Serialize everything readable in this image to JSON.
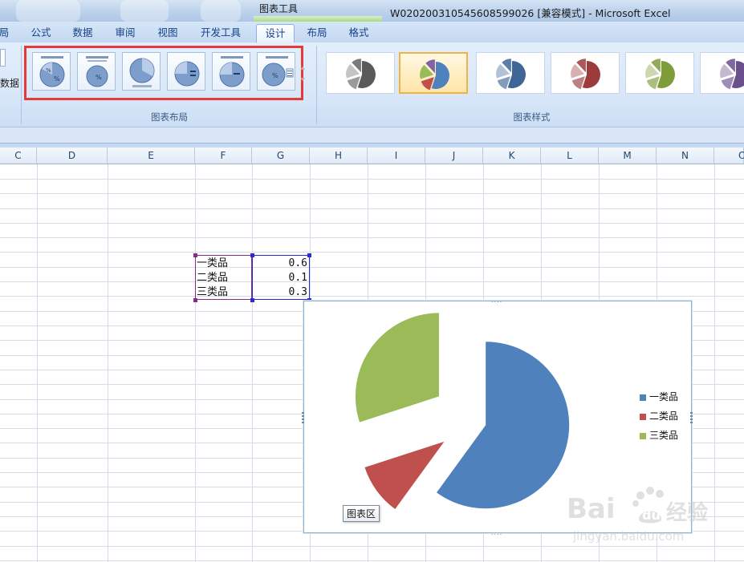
{
  "window": {
    "context_tab_group": "图表工具",
    "title": "W02020031054560859​9026  [兼容模式] - Microsoft Excel"
  },
  "tabs": [
    {
      "label": "局"
    },
    {
      "label": "公式"
    },
    {
      "label": "数据"
    },
    {
      "label": "审阅"
    },
    {
      "label": "视图"
    },
    {
      "label": "开发工具"
    },
    {
      "label": "设计"
    },
    {
      "label": "布局"
    },
    {
      "label": "格式"
    }
  ],
  "ribbon": {
    "left_group_label": "数据",
    "layout_group_label": "图表布局",
    "style_group_label": "图表样式",
    "chart_layouts": [
      {
        "name": "layout-1"
      },
      {
        "name": "layout-2"
      },
      {
        "name": "layout-3"
      },
      {
        "name": "layout-4"
      },
      {
        "name": "layout-5"
      },
      {
        "name": "layout-6"
      }
    ],
    "chart_styles": [
      {
        "accent": "#5a5a5a"
      },
      {
        "accent": "#4f81bd",
        "selected": true
      },
      {
        "accent": "#3e6798"
      },
      {
        "accent": "#9b3b3b"
      },
      {
        "accent": "#7f9c3a"
      },
      {
        "accent": "#6a4f8c"
      }
    ]
  },
  "columns": [
    "C",
    "D",
    "E",
    "F",
    "G",
    "H",
    "I",
    "J",
    "K",
    "L",
    "M",
    "N",
    "O"
  ],
  "cells": [
    {
      "label": "一类品",
      "value": "0.6"
    },
    {
      "label": "二类品",
      "value": "0.1"
    },
    {
      "label": "三类品",
      "value": "0.3"
    }
  ],
  "chart_data": {
    "type": "pie",
    "exploded": true,
    "categories": [
      "一类品",
      "二类品",
      "三类品"
    ],
    "values": [
      0.6,
      0.1,
      0.3
    ],
    "colors": [
      "#4f81bd",
      "#c0504d",
      "#9bbb59"
    ],
    "legend_position": "right"
  },
  "chart_tooltip": "图表区",
  "watermark": {
    "brand": "Baidu 经验",
    "url": "jingyan.baidu.com"
  }
}
